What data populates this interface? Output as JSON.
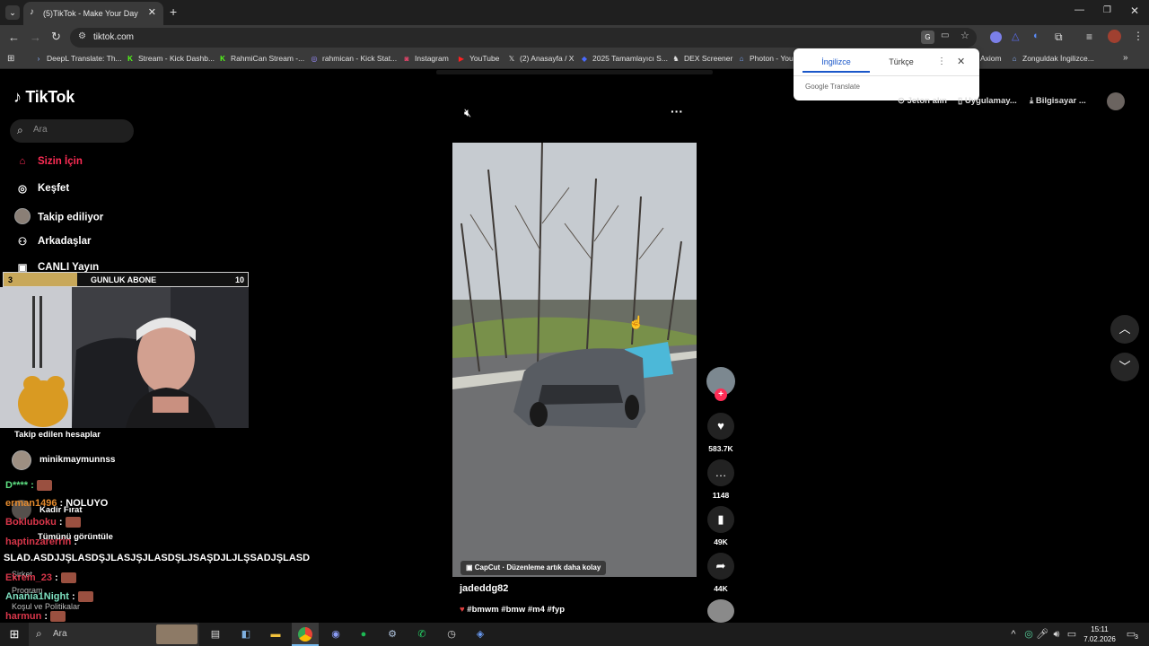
{
  "browser": {
    "tab_title": "(5)TikTok - Make Your Day",
    "url": "tiktok.com",
    "bookmarks": [
      "DeepL Translate: Th...",
      "Stream - Kick Dashb...",
      "RahmiCan Stream -...",
      "rahmican - Kick Stat...",
      "Instagram",
      "YouTube",
      "(2) Anasayfa / X",
      "2025 Tamamlayıcı S...",
      "DEX Screener",
      "Photon - You",
      "Axiom",
      "Zonguldak İngilizce..."
    ]
  },
  "translate_popup": {
    "tab_source": "İngilizce",
    "tab_target": "Türkçe",
    "brand": "Google Translate"
  },
  "tiktok": {
    "logo": "TikTok",
    "search_placeholder": "Ara",
    "nav": [
      "Sizin İçin",
      "Keşfet",
      "Takip ediliyor",
      "Arkadaşlar",
      "CANLI Yayın"
    ],
    "header_right": {
      "coins": "Jeton alın",
      "app": "Uygulamay...",
      "pc": "Bilgisayar ..."
    },
    "following_title": "Takip edilen hesaplar",
    "following": [
      "minikmaymunnss",
      "Kadir Fırat"
    ],
    "see_all": "Tümünü görüntüle",
    "footer_links": [
      "Şirket",
      "Program",
      "Koşul ve Politikalar"
    ],
    "video": {
      "author": "jadeddg82",
      "caption": "#bmwm #bmw #m4 #fyp",
      "capcut": "CapCut · Düzenleme artık daha kolay"
    },
    "actions": {
      "likes": "583.7K",
      "comments": "1148",
      "bookmarks": "49K",
      "shares": "44K"
    }
  },
  "overlay": {
    "abone_left": "3",
    "abone_title": "GUNLUK ABONE",
    "abone_right": "10",
    "abone_progress": 0.3,
    "chat": [
      {
        "user": "erman1496",
        "msg": "NOLUYO",
        "color": "#e58b2e"
      },
      {
        "user": "Bokluboku",
        "msg": "",
        "color": "#d9364a"
      },
      {
        "user": "haptinzarerrin",
        "msg": "",
        "color": "#d9364a"
      },
      {
        "user": "",
        "msg": "SLAD.ASDJJŞLASDŞJLASJŞJLASDŞLJSAŞDJLJLŞSADJŞLASD",
        "color": "#ffffff"
      },
      {
        "user": "Ekrem_23",
        "msg": "",
        "color": "#d9364a"
      },
      {
        "user": "Anania1Night",
        "msg": "",
        "color": "#7ee0c0"
      },
      {
        "user": "harmun",
        "msg": "",
        "color": "#d9364a"
      }
    ]
  },
  "taskbar": {
    "search_placeholder": "Ara",
    "time": "15:11",
    "date": "7.02.2026",
    "notifications": "3"
  }
}
